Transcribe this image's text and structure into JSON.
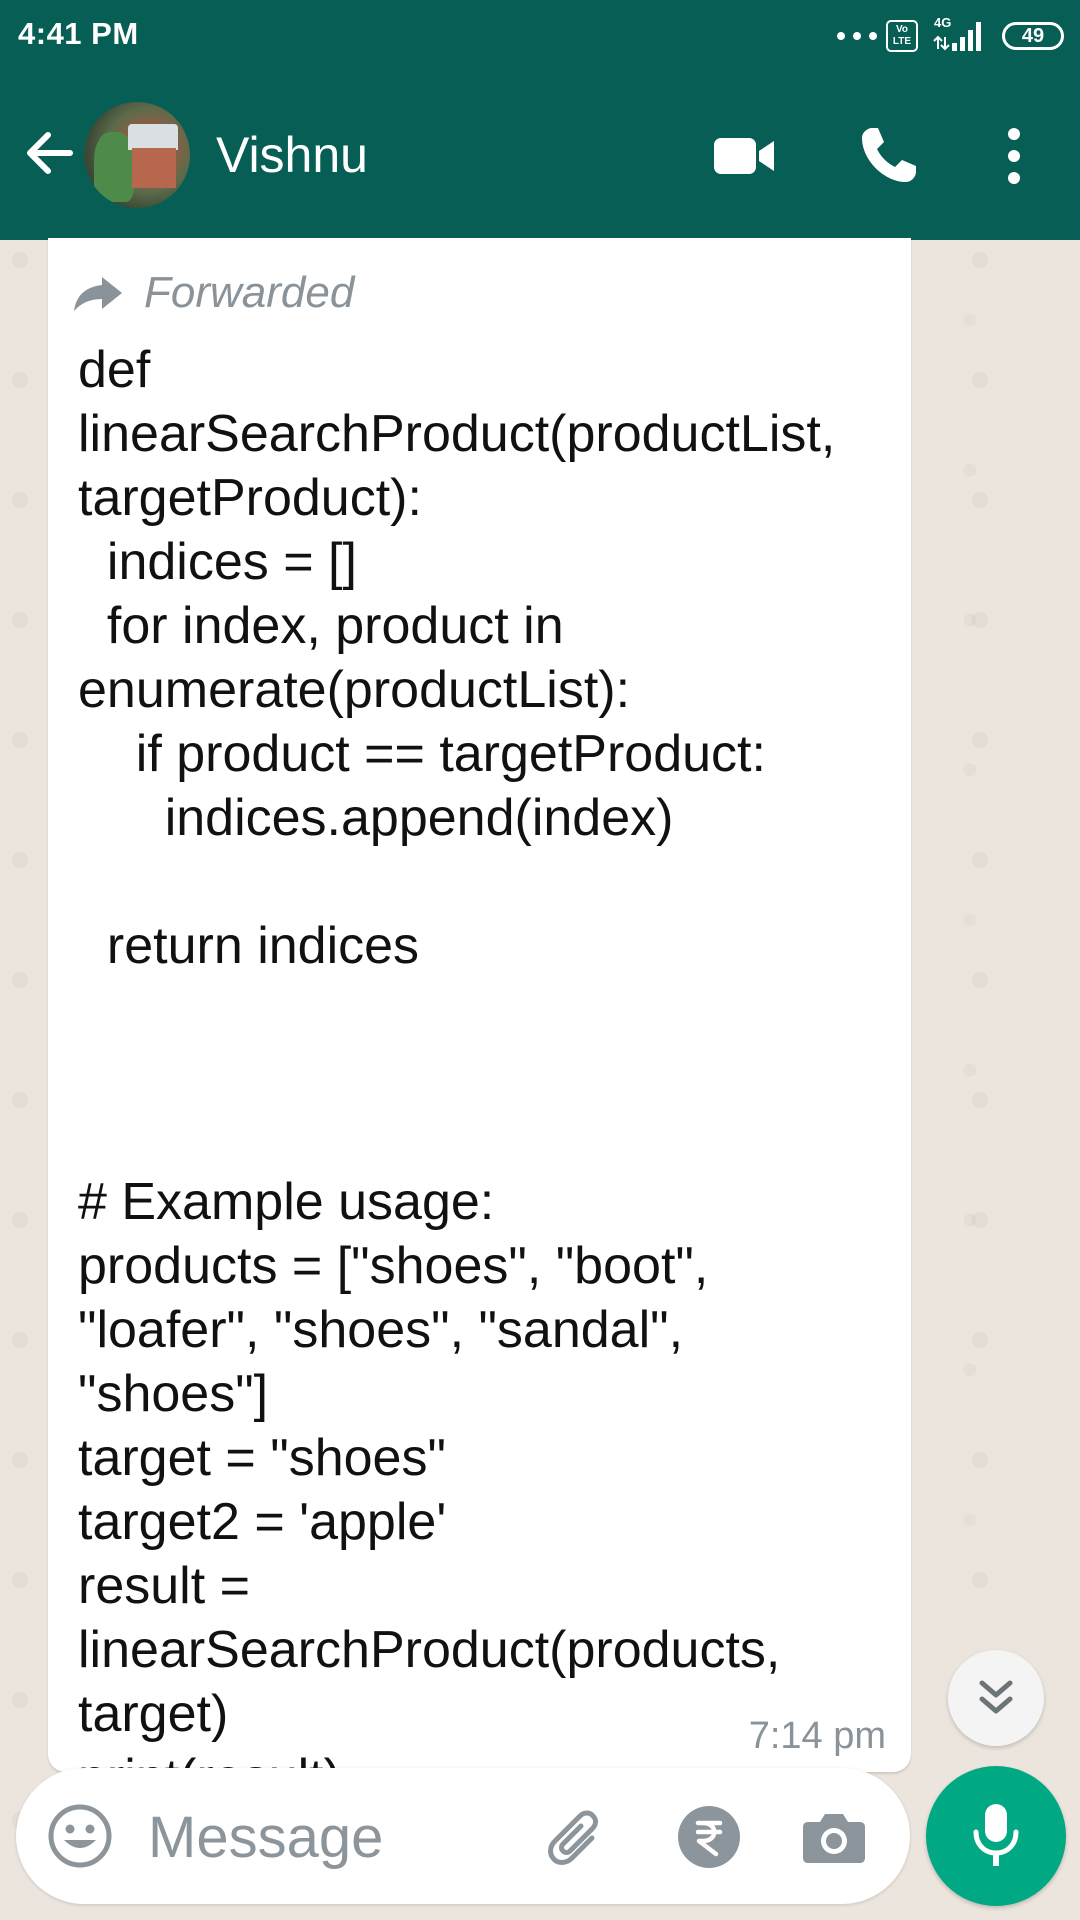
{
  "status_bar": {
    "time": "4:41 PM",
    "network_type": "4G",
    "volte_label": "Vo\nLTE",
    "battery": "49"
  },
  "header": {
    "contact_name": "Vishnu",
    "icons": [
      "back-arrow-icon",
      "avatar",
      "video-call-icon",
      "phone-icon",
      "more-options-icon"
    ],
    "color": "#075e54"
  },
  "message": {
    "forwarded_label": "Forwarded",
    "text": "def\nlinearSearchProduct(productList,\ntargetProduct):\n  indices = []\n  for index, product in\nenumerate(productList):\n    if product == targetProduct:\n      indices.append(index)\n\n  return indices\n\n\n\n# Example usage:\nproducts = [\"shoes\", \"boot\",\n\"loafer\", \"shoes\", \"sandal\",\n\"shoes\"]\ntarget = \"shoes\"\ntarget2 = 'apple'\nresult =\nlinearSearchProduct(products,\ntarget)\nprint(result)",
    "time": "7:14 pm"
  },
  "composer": {
    "placeholder": "Message",
    "value": "",
    "icons": [
      "emoji-icon",
      "attach-icon",
      "rupee-payment-icon",
      "camera-icon",
      "mic-icon"
    ],
    "mic_color": "#00a884"
  }
}
